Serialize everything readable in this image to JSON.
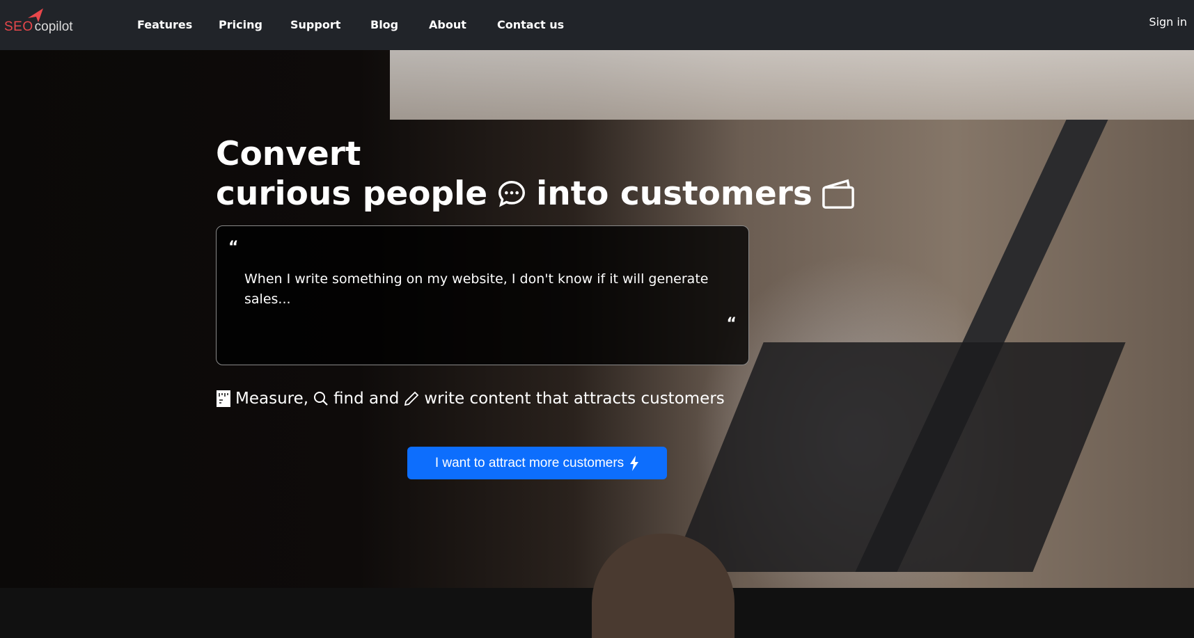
{
  "brand": {
    "logo_red": "SEO",
    "logo_rest": "copilot",
    "accent": "#e8474b"
  },
  "nav": {
    "items": [
      "Features",
      "Pricing",
      "Support",
      "Blog",
      "About",
      "Contact us"
    ],
    "sign_in": "Sign in"
  },
  "hero": {
    "title_line1": "Convert",
    "title_part1": "curious people",
    "title_part2": "into customers",
    "quote": "When I write something on my website, I don't know if it will generate sales...",
    "quote_mark": "“",
    "tag_measure": "Measure,",
    "tag_find": "find and",
    "tag_write": "write content that attracts customers",
    "cta": "I want to attract more customers",
    "cta_color": "#0d6efd"
  }
}
